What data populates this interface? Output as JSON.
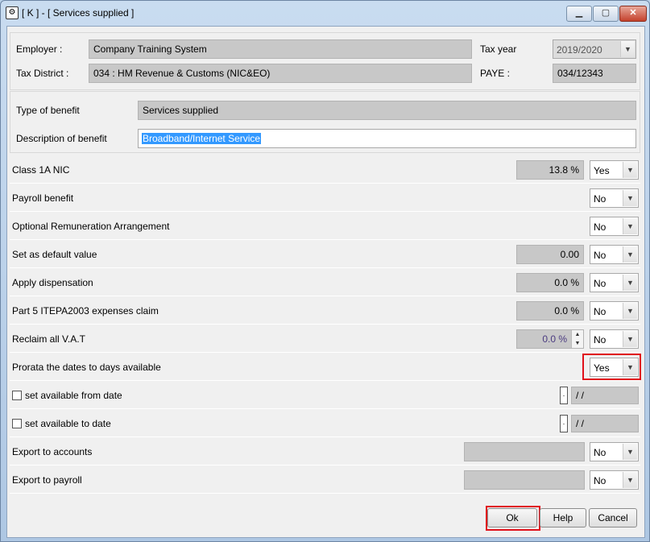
{
  "window": {
    "title": "[ K ] - [ Services supplied ]"
  },
  "employer": {
    "employer_label": "Employer :",
    "employer_value": "Company Training System",
    "district_label": "Tax District :",
    "district_value": "034 : HM Revenue & Customs (NIC&EO)",
    "taxyear_label": "Tax year",
    "taxyear_value": "2019/2020",
    "paye_label": "PAYE :",
    "paye_value": "034/12343"
  },
  "benefit": {
    "type_label": "Type of benefit",
    "type_value": "Services supplied",
    "desc_label": "Description of benefit",
    "desc_value": "Broadband/Internet Service"
  },
  "rows": [
    {
      "label": "Class 1A NIC",
      "value": "13.8 %",
      "option": "Yes"
    },
    {
      "label": "Payroll benefit",
      "option": "No"
    },
    {
      "label": "Optional Remuneration Arrangement",
      "option": "No"
    },
    {
      "label": "Set as default value",
      "value": "0.00",
      "option": "No"
    },
    {
      "label": "Apply dispensation",
      "value": "0.0 %",
      "option": "No"
    },
    {
      "label": "Part 5 ITEPA2003 expenses claim",
      "value": "0.0 %",
      "option": "No"
    },
    {
      "label": "Reclaim all V.A.T",
      "value": "0.0 %",
      "option": "No"
    },
    {
      "label": "Prorata the dates to days available",
      "option": "Yes"
    },
    {
      "label": "set available from date",
      "date": " / /"
    },
    {
      "label": "set available to date",
      "date": " / /"
    },
    {
      "label": "Export to accounts",
      "option": "No"
    },
    {
      "label": "Export to payroll",
      "option": "No"
    }
  ],
  "buttons": {
    "ok": "Ok",
    "help": "Help",
    "cancel": "Cancel"
  },
  "colors": {
    "highlight": "#e0101a",
    "selection": "#3399ff"
  }
}
